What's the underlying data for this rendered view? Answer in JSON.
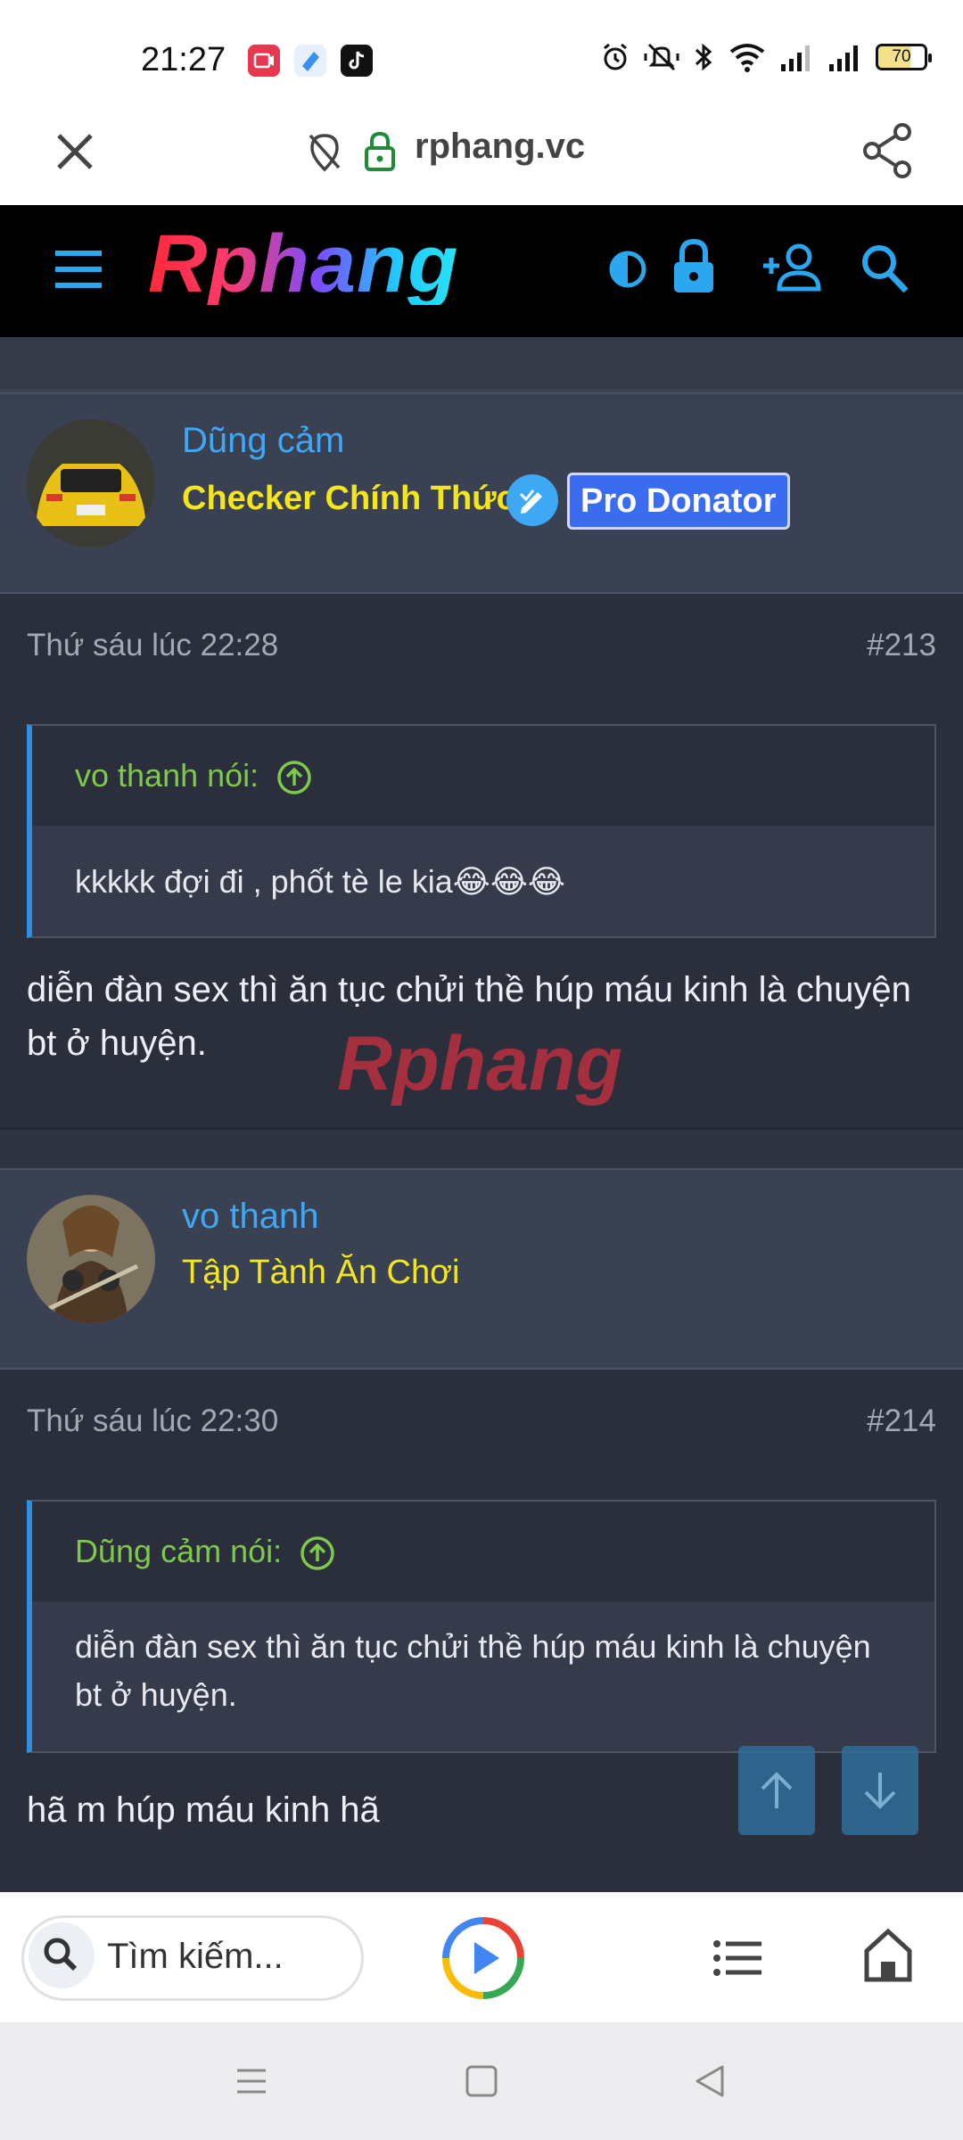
{
  "status_bar": {
    "time": "21:27",
    "battery": "70",
    "icons": [
      "alarm-icon",
      "mute-icon",
      "bluetooth-icon",
      "wifi-icon",
      "signal-icon",
      "signal-icon"
    ]
  },
  "browser": {
    "url": "rphang.vc",
    "close_icon": "close-icon",
    "share_icon": "share-icon"
  },
  "site_header": {
    "logo_text": "Rphang",
    "icons": [
      "menu-icon",
      "theme-toggle-icon",
      "login-lock-icon",
      "register-icon",
      "search-icon"
    ]
  },
  "posts": [
    {
      "username": "Dũng cảm",
      "user_title": "Checker Chính Thức",
      "badge": "Pro Donator",
      "date": "Thứ sáu lúc 22:28",
      "number": "#213",
      "quote_author": "vo thanh nói:",
      "quote_text": "kkkkk đợi đi , phốt tè le kia😂😂😂",
      "message": "diễn đàn sex thì ăn tục chửi thề húp máu kinh là chuyện bt ở huyện.",
      "watermark": "Rphang"
    },
    {
      "username": "vo thanh",
      "user_title": "Tập Tành Ăn Chơi",
      "date": "Thứ sáu lúc 22:30",
      "number": "#214",
      "quote_author": "Dũng cảm nói:",
      "quote_text": "diễn đàn sex thì ăn tục chửi thề húp máu kinh là chuyện bt ở huyện.",
      "message": "hã m húp máu kinh hã"
    }
  ],
  "bottom_toolbar": {
    "search_placeholder": "Tìm kiếm..."
  },
  "colors": {
    "accent_blue": "#3ea8f5",
    "title_yellow": "#f3e61a",
    "quote_green": "#7ec84a",
    "badge_blue": "#3b6cf0"
  }
}
